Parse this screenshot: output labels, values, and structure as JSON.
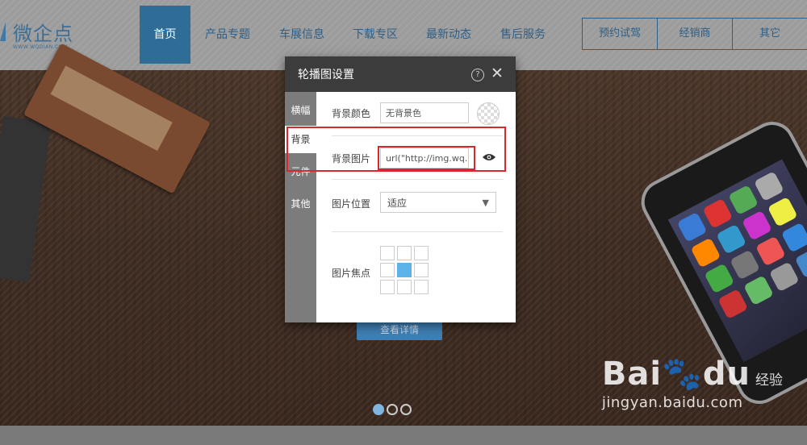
{
  "header": {
    "logo_text": "微企点",
    "logo_sub": "WWW.WQDIAN.COM",
    "nav": [
      {
        "label": "首页",
        "active": true
      },
      {
        "label": "产品专题"
      },
      {
        "label": "车展信息"
      },
      {
        "label": "下载专区"
      },
      {
        "label": "最新动态"
      },
      {
        "label": "售后服务"
      }
    ],
    "buttons": [
      "预约试驾",
      "经销商",
      "其它"
    ]
  },
  "banner": {
    "cta_label": "查看详情",
    "slides": [
      {
        "active": true
      },
      {
        "active": false
      },
      {
        "active": false
      }
    ]
  },
  "watermark": {
    "brand": "Bai",
    "brand2": "du",
    "suffix": "经验",
    "url": "jingyan.baidu.com"
  },
  "dialog": {
    "title": "轮播图设置",
    "help_icon": "?",
    "close_icon": "✕",
    "tabs": [
      "横幅",
      "背景",
      "元件",
      "其他"
    ],
    "active_tab": 1,
    "bg_color": {
      "label": "背景颜色",
      "value": "无背景色"
    },
    "bg_image": {
      "label": "背景图片",
      "value": "url(\"http://img.wq..."
    },
    "position": {
      "label": "图片位置",
      "value": "适应"
    },
    "focus": {
      "label": "图片焦点",
      "selected_index": 4
    }
  },
  "colors": {
    "highlight": "#d8282e",
    "accent": "#2f6d97",
    "focus_selected": "#5db3e8"
  }
}
